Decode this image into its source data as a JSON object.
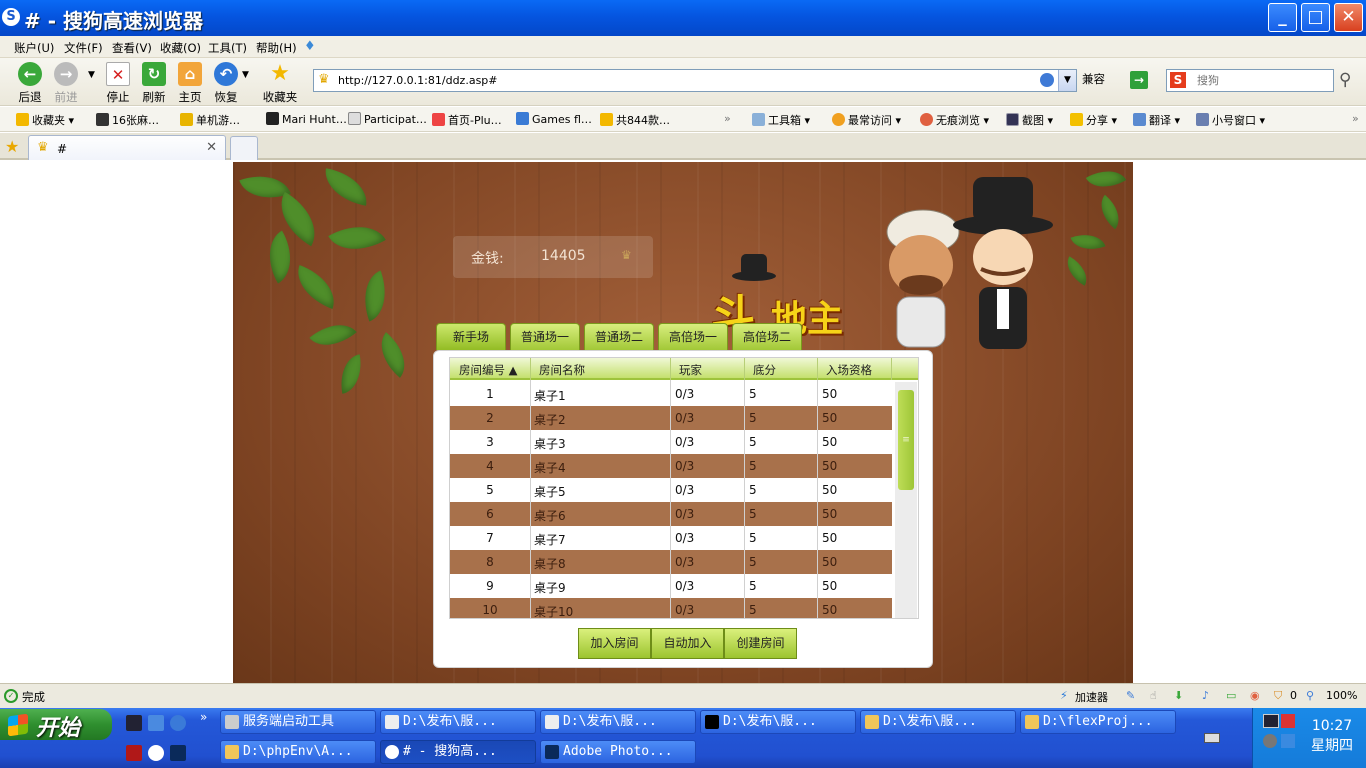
{
  "window": {
    "title": "# - 搜狗高速浏览器",
    "logo_letter": "S",
    "minimize": "_",
    "maximize": "□",
    "close": "✕"
  },
  "menu": [
    "账户(U)",
    "文件(F)",
    "查看(V)",
    "收藏(O)",
    "工具(T)",
    "帮助(H)"
  ],
  "nav": {
    "back": "后退",
    "forward": "前进",
    "stop": "停止",
    "refresh": "刷新",
    "home": "主页",
    "restore": "恢复",
    "favorites": "收藏夹",
    "url": "http://127.0.0.1:81/ddz.asp#",
    "compat": "兼容",
    "search_placeholder": "搜狗",
    "search_logo": "S"
  },
  "favbar": {
    "items": [
      "收藏夹",
      "16张麻…",
      "单机游…",
      "Mari Huht…",
      "Participat…",
      "首页-Plu…",
      "Games fl…",
      "共844款…"
    ],
    "tools": [
      "工具箱",
      "最常访问",
      "无痕浏览",
      "截图",
      "分享",
      "翻译",
      "小号窗口"
    ]
  },
  "tabs": [
    {
      "title": "#"
    }
  ],
  "game": {
    "money_label": "金钱:",
    "money_value": "14405",
    "logo_big": "斗",
    "logo_small": "地主",
    "room_tabs": [
      "新手场",
      "普通场一",
      "普通场二",
      "高倍场一",
      "高倍场二"
    ],
    "columns": [
      "房间编号",
      "房间名称",
      "玩家",
      "底分",
      "入场资格"
    ],
    "sort_indicator": "▲",
    "rows": [
      {
        "id": "1",
        "name": "桌子1",
        "players": "0/3",
        "base": "5",
        "entry": "50"
      },
      {
        "id": "2",
        "name": "桌子2",
        "players": "0/3",
        "base": "5",
        "entry": "50"
      },
      {
        "id": "3",
        "name": "桌子3",
        "players": "0/3",
        "base": "5",
        "entry": "50"
      },
      {
        "id": "4",
        "name": "桌子4",
        "players": "0/3",
        "base": "5",
        "entry": "50"
      },
      {
        "id": "5",
        "name": "桌子5",
        "players": "0/3",
        "base": "5",
        "entry": "50"
      },
      {
        "id": "6",
        "name": "桌子6",
        "players": "0/3",
        "base": "5",
        "entry": "50"
      },
      {
        "id": "7",
        "name": "桌子7",
        "players": "0/3",
        "base": "5",
        "entry": "50"
      },
      {
        "id": "8",
        "name": "桌子8",
        "players": "0/3",
        "base": "5",
        "entry": "50"
      },
      {
        "id": "9",
        "name": "桌子9",
        "players": "0/3",
        "base": "5",
        "entry": "50"
      },
      {
        "id": "10",
        "name": "桌子10",
        "players": "0/3",
        "base": "5",
        "entry": "50"
      }
    ],
    "buttons": [
      "加入房间",
      "自动加入",
      "创建房间"
    ],
    "colors": {
      "row_alt": "#a8714b",
      "accent_green": "#a2c837",
      "wood": "#8a4a27"
    }
  },
  "status": {
    "text": "完成",
    "accelerator": "加速器",
    "badge": "0",
    "zoom": "100%"
  },
  "taskbar": {
    "start": "开始",
    "row1": [
      "服务端启动工具",
      "D:\\发布\\服...",
      "D:\\发布\\服...",
      "D:\\发布\\服...",
      "D:\\发布\\服...",
      "D:\\flexProj..."
    ],
    "row2": [
      "D:\\phpEnv\\A...",
      "# - 搜狗高...",
      "Adobe Photo..."
    ],
    "time": "10:27",
    "day": "星期四"
  }
}
